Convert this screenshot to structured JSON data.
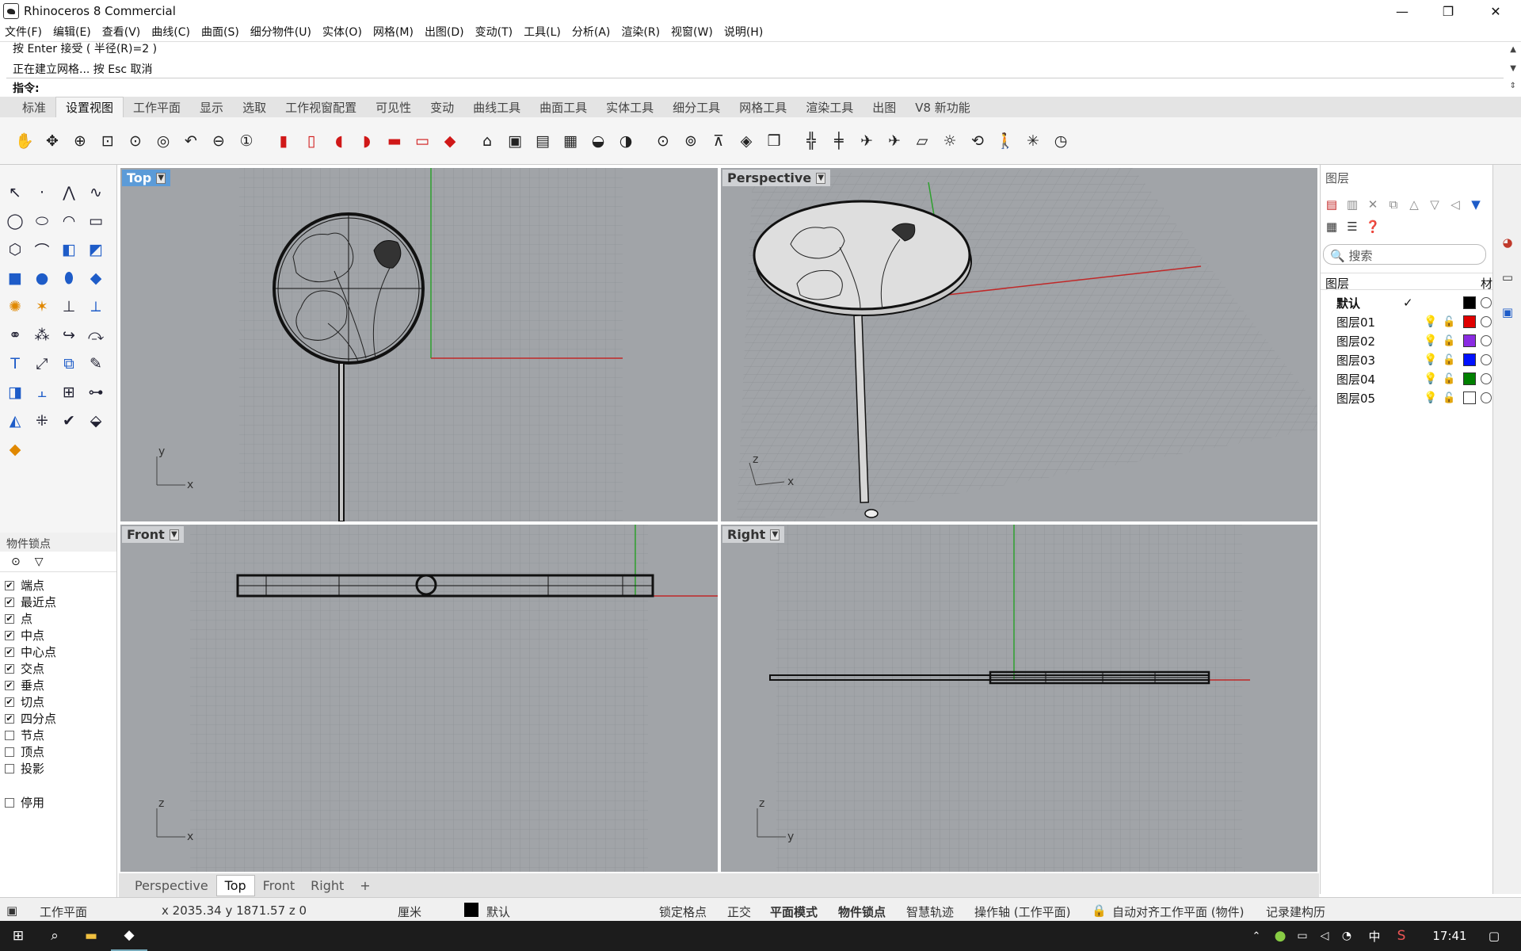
{
  "app": {
    "title": "Rhinoceros 8 Commercial",
    "minimize": "—",
    "restore": "❐",
    "close": "✕"
  },
  "menu": [
    "文件(F)",
    "编辑(E)",
    "查看(V)",
    "曲线(C)",
    "曲面(S)",
    "细分物件(U)",
    "实体(O)",
    "网格(M)",
    "出图(D)",
    "变动(T)",
    "工具(L)",
    "分析(A)",
    "渲染(R)",
    "视窗(W)",
    "说明(H)"
  ],
  "command": {
    "history1": "按 Enter 接受 ( 半径(R)=2 )",
    "history2": "正在建立网格... 按 Esc 取消",
    "prompt": "指令:"
  },
  "tabs": [
    "标准",
    "设置视图",
    "工作平面",
    "显示",
    "选取",
    "工作视窗配置",
    "可见性",
    "变动",
    "曲线工具",
    "曲面工具",
    "实体工具",
    "细分工具",
    "网格工具",
    "渲染工具",
    "出图",
    "V8 新功能"
  ],
  "active_tab": "设置视图",
  "toolbar_icons": [
    "pan-icon",
    "rotate-view-icon",
    "zoom-icon",
    "zoom-extents-icon",
    "zoom-window-icon",
    "zoom-selected-icon",
    "undo-view-icon",
    "zoom-out-icon",
    "one-to-one-icon",
    "view-front-icon",
    "view-back-icon",
    "view-left-icon",
    "view-right-icon",
    "view-top-icon",
    "view-bottom-icon",
    "view-perspective-icon",
    "camera-icon",
    "snapshot-icon",
    "named-view-icon",
    "wallpaper-icon",
    "place-camera-icon",
    "light-icon",
    "target-icon",
    "set-target-icon",
    "set-camera-icon",
    "iso-view-icon",
    "box-view-icon",
    "clipping-plane-icon",
    "section-icon",
    "fly-icon",
    "fly-2-icon",
    "ground-plane-icon",
    "sun-icon",
    "turntable-icon",
    "walk-icon",
    "explode-icon",
    "clock-icon"
  ],
  "viewports": {
    "top": "Top",
    "perspective": "Perspective",
    "front": "Front",
    "right": "Right",
    "axis_x": "x",
    "axis_y": "y",
    "axis_z": "z"
  },
  "osnap": {
    "title": "物件锁点",
    "items": [
      {
        "label": "端点",
        "checked": true
      },
      {
        "label": "最近点",
        "checked": true
      },
      {
        "label": "点",
        "checked": true
      },
      {
        "label": "中点",
        "checked": true
      },
      {
        "label": "中心点",
        "checked": true
      },
      {
        "label": "交点",
        "checked": true
      },
      {
        "label": "垂点",
        "checked": true
      },
      {
        "label": "切点",
        "checked": true
      },
      {
        "label": "四分点",
        "checked": true
      },
      {
        "label": "节点",
        "checked": false
      },
      {
        "label": "顶点",
        "checked": false
      },
      {
        "label": "投影",
        "checked": false
      }
    ],
    "disable": "停用",
    "check": "✔"
  },
  "vp_tabs": [
    "Perspective",
    "Top",
    "Front",
    "Right"
  ],
  "vp_tabs_active": "Top",
  "vp_tabs_add": "+",
  "layers": {
    "title": "图层",
    "search": "搜索",
    "col_layer": "图层",
    "col_mat": "材",
    "current_mark": "✓",
    "rows": [
      {
        "name": "默认",
        "color": "#000000",
        "current": true
      },
      {
        "name": "图层01",
        "color": "#e00000"
      },
      {
        "name": "图层02",
        "color": "#8a2be2"
      },
      {
        "name": "图层03",
        "color": "#0010ff"
      },
      {
        "name": "图层04",
        "color": "#008000"
      },
      {
        "name": "图层05",
        "color": "#ffffff"
      }
    ]
  },
  "status": {
    "cplane": "工作平面",
    "coords": "x 2035.34  y 1871.57  z 0",
    "unit": "厘米",
    "layer": "默认",
    "grid_snap": "锁定格点",
    "ortho": "正交",
    "planar": "平面模式",
    "osnap": "物件锁点",
    "smart_track": "智慧轨迹",
    "gumball": "操作轴 (工作平面)",
    "auto_cplane": "自动对齐工作平面 (物件)",
    "record": "记录建构历"
  },
  "taskbar": {
    "time": "17:41",
    "ime": "中"
  }
}
